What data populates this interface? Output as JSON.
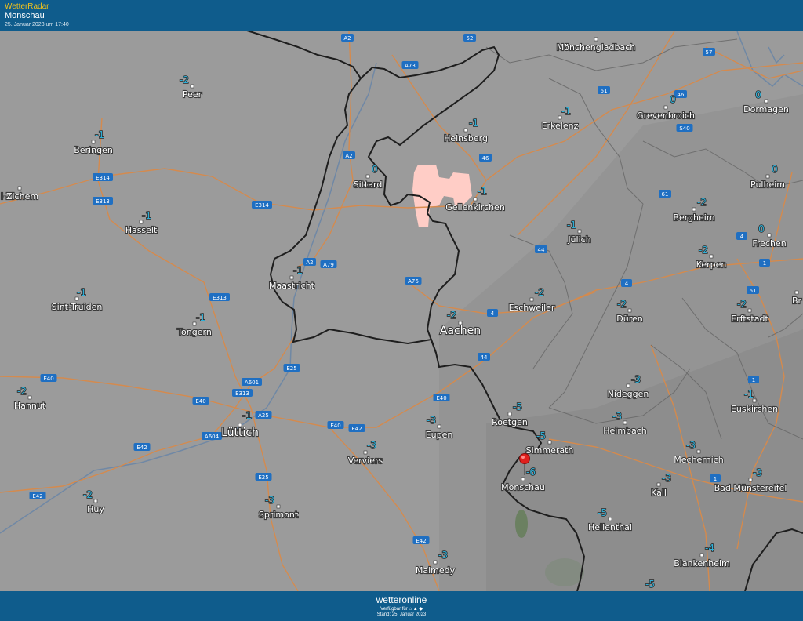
{
  "header": {
    "brand": "WetterRadar",
    "location": "Monschau",
    "timestamp": "25. Januar 2023 um 17:40"
  },
  "footer": {
    "logo": "wetteronline",
    "available": "Verfügbar für  ⌂ ▲ ◆",
    "stand": "Stand: 25. Januar 2023"
  },
  "colors": {
    "header_bg": "#0f5c8c",
    "brand": "#f2c21b",
    "temperature": "#2fb0d8",
    "radar_echo": "#ffcdc6",
    "marker": "#e0201d"
  },
  "map": {
    "marker": {
      "icon": "location-pin-icon",
      "location": "Monschau"
    },
    "cities": [
      {
        "name": "Peer",
        "temp": "-2"
      },
      {
        "name": "Beringen",
        "temp": "-1"
      },
      {
        "name": "Hasselt",
        "temp": "-1"
      },
      {
        "name": "l-Zichem",
        "temp": ""
      },
      {
        "name": "Sint-Truiden",
        "temp": "-1"
      },
      {
        "name": "Tongern",
        "temp": "-1"
      },
      {
        "name": "Hannut",
        "temp": "-2"
      },
      {
        "name": "Huy",
        "temp": "-2"
      },
      {
        "name": "Lüttich",
        "temp": "-1"
      },
      {
        "name": "Sprimont",
        "temp": "-3"
      },
      {
        "name": "Verviers",
        "temp": "-3"
      },
      {
        "name": "Eupen",
        "temp": "-3"
      },
      {
        "name": "Malmedy",
        "temp": "-3"
      },
      {
        "name": "Maastricht",
        "temp": "-1"
      },
      {
        "name": "Sittard",
        "temp": "0"
      },
      {
        "name": "Heinsberg",
        "temp": "-1"
      },
      {
        "name": "Geilenkirchen",
        "temp": "-1"
      },
      {
        "name": "Erkelenz",
        "temp": "-1"
      },
      {
        "name": "Mönchengladbach",
        "temp": ""
      },
      {
        "name": "Aachen",
        "temp": "-2"
      },
      {
        "name": "Eschweiler",
        "temp": "-2"
      },
      {
        "name": "Jülich",
        "temp": "-1"
      },
      {
        "name": "Düren",
        "temp": "-2"
      },
      {
        "name": "Roetgen",
        "temp": "-5"
      },
      {
        "name": "Simmerath",
        "temp": "-5"
      },
      {
        "name": "Monschau",
        "temp": "-6"
      },
      {
        "name": "Nideggen",
        "temp": "-3"
      },
      {
        "name": "Heimbach",
        "temp": "-3"
      },
      {
        "name": "Hellenthal",
        "temp": "-5"
      },
      {
        "name": "Grevenbroich",
        "temp": "0"
      },
      {
        "name": "Dormagen",
        "temp": "0"
      },
      {
        "name": "Pulheim",
        "temp": "0"
      },
      {
        "name": "Bergheim",
        "temp": "-2"
      },
      {
        "name": "Frechen",
        "temp": "0"
      },
      {
        "name": "Kerpen",
        "temp": "-2"
      },
      {
        "name": "Erftstadt",
        "temp": "-2"
      },
      {
        "name": "Euskirchen",
        "temp": "-1"
      },
      {
        "name": "Mechernich",
        "temp": "-3"
      },
      {
        "name": "Kall",
        "temp": "-3"
      },
      {
        "name": "Bad Münstereifel",
        "temp": "-3"
      },
      {
        "name": "Blankenheim",
        "temp": "-4"
      },
      {
        "name": "",
        "temp": "-5"
      },
      {
        "name": "Br",
        "temp": ""
      }
    ],
    "roads": [
      "A2",
      "A73",
      "52",
      "57",
      "61",
      "46",
      "S40",
      "A2",
      "E314",
      "E313",
      "E314",
      "A2",
      "A79",
      "46",
      "61",
      "44",
      "A76",
      "4",
      "4",
      "44",
      "E313",
      "E25",
      "E40",
      "A601",
      "E313",
      "E40",
      "A25",
      "A604",
      "E40",
      "E42",
      "E42",
      "E40",
      "E42",
      "E25",
      "E42",
      "4",
      "1",
      "61",
      "1",
      "1"
    ]
  }
}
